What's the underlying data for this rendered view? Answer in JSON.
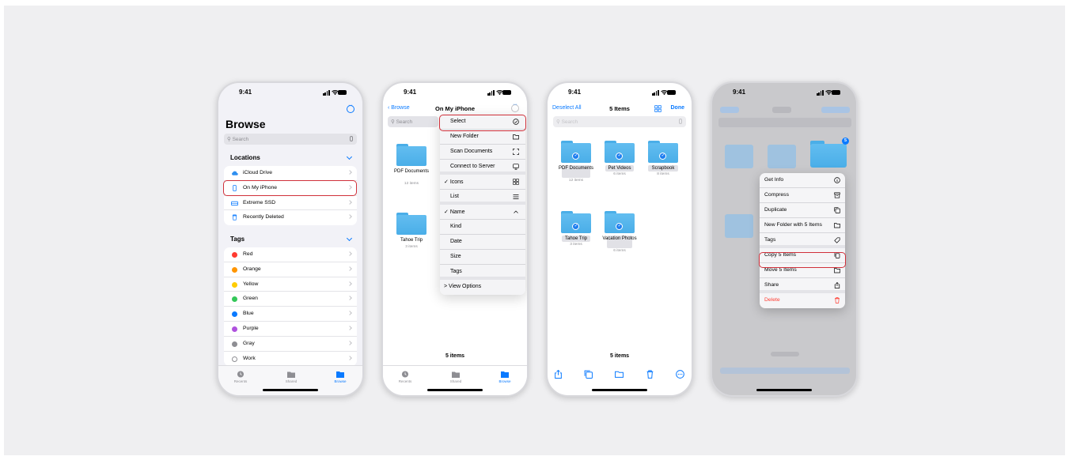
{
  "status_time": "9:41",
  "colors": {
    "accent": "#0a7aff",
    "highlight": "#d0303a",
    "folder": "#4aaee8",
    "destructive": "#ff3b30"
  },
  "screen1": {
    "title": "Browse",
    "search_placeholder": "Search",
    "locations_header": "Locations",
    "locations": [
      {
        "label": "iCloud Drive",
        "icon": "cloud-icon"
      },
      {
        "label": "On My iPhone",
        "icon": "phone-icon"
      },
      {
        "label": "Extreme SSD",
        "icon": "drive-icon"
      },
      {
        "label": "Recently Deleted",
        "icon": "trash-icon"
      }
    ],
    "tags_header": "Tags",
    "tags": [
      {
        "label": "Red",
        "color": "#ff3b30"
      },
      {
        "label": "Orange",
        "color": "#ff9500"
      },
      {
        "label": "Yellow",
        "color": "#ffcc00"
      },
      {
        "label": "Green",
        "color": "#34c759"
      },
      {
        "label": "Blue",
        "color": "#0a7aff"
      },
      {
        "label": "Purple",
        "color": "#af52de"
      },
      {
        "label": "Gray",
        "color": "#8e8e93"
      },
      {
        "label": "Work",
        "color": ""
      }
    ],
    "tabs": [
      "Recents",
      "Shared",
      "Browse"
    ]
  },
  "screen2": {
    "back_label": "Browse",
    "title": "On My iPhone",
    "search_placeholder": "Search",
    "folders": [
      {
        "name": "PDF Documents",
        "count": "12 items"
      },
      {
        "name": "Tahoe Trip",
        "count": "3 items"
      }
    ],
    "menu": [
      {
        "label": "Select",
        "icon": "checkmark-circle-icon"
      },
      {
        "label": "New Folder",
        "icon": "folder-plus-icon"
      },
      {
        "label": "Scan Documents",
        "icon": "scan-icon"
      },
      {
        "label": "Connect to Server",
        "icon": "monitor-icon"
      },
      {
        "label": "Icons",
        "icon": "grid-icon",
        "checked": true
      },
      {
        "label": "List",
        "icon": "list-icon"
      },
      {
        "label": "Name",
        "icon": "chevron-up-icon",
        "checked": true
      },
      {
        "label": "Kind"
      },
      {
        "label": "Date"
      },
      {
        "label": "Size"
      },
      {
        "label": "Tags"
      },
      {
        "label": "> View Options"
      }
    ],
    "footer": "5 items",
    "tabs": [
      "Recents",
      "Shared",
      "Browse"
    ]
  },
  "screen3": {
    "deselect_label": "Deselect All",
    "title": "5 Items",
    "done_label": "Done",
    "search_placeholder": "Search",
    "folders": [
      {
        "name": "PDF Documents",
        "count": "12 items"
      },
      {
        "name": "Pet Videos",
        "count": "6 items"
      },
      {
        "name": "Scrapbook",
        "count": "8 items"
      },
      {
        "name": "Tahoe Trip",
        "count": "3 items"
      },
      {
        "name": "Vacation Photos",
        "count": "6 items"
      }
    ],
    "footer": "5 items"
  },
  "screen4": {
    "badge": "5",
    "menu": [
      {
        "label": "Get Info",
        "icon": "info-icon"
      },
      {
        "label": "Compress",
        "icon": "archive-icon"
      },
      {
        "label": "Duplicate",
        "icon": "duplicate-icon"
      },
      {
        "label": "New Folder with 5 Items",
        "icon": "folder-plus-icon"
      },
      {
        "label": "Tags",
        "icon": "tag-icon"
      },
      {
        "label": "Copy 5 Items",
        "icon": "copy-icon"
      },
      {
        "label": "Move 5 Items",
        "icon": "folder-icon"
      },
      {
        "label": "Share",
        "icon": "share-icon"
      },
      {
        "label": "Delete",
        "icon": "trash-icon"
      }
    ]
  }
}
